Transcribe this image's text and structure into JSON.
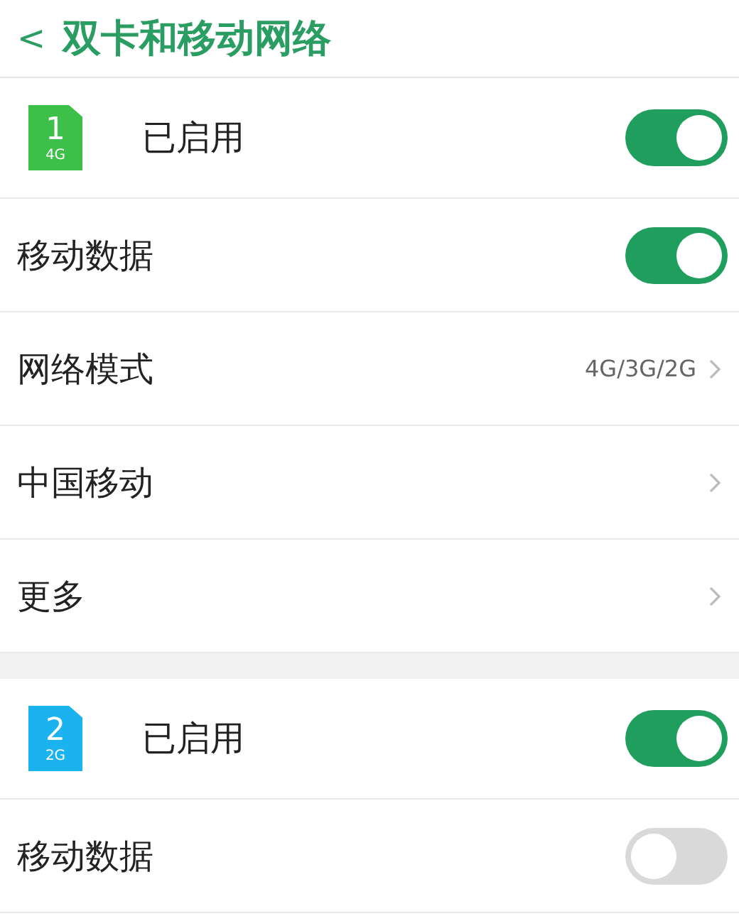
{
  "header": {
    "back": "<",
    "title": "双卡和移动网络"
  },
  "sections": [
    {
      "rows": [
        {
          "kind": "sim",
          "slot": "1",
          "network": "4G",
          "color": "#3cc04a",
          "label": "已启用",
          "on": true
        },
        {
          "kind": "toggle",
          "label": "移动数据",
          "on": true
        },
        {
          "kind": "link",
          "label": "网络模式",
          "value": "4G/3G/2G"
        },
        {
          "kind": "link",
          "label": "中国移动"
        },
        {
          "kind": "link",
          "label": "更多"
        }
      ]
    },
    {
      "rows": [
        {
          "kind": "sim",
          "slot": "2",
          "network": "2G",
          "color": "#1ab2ef",
          "label": "已启用",
          "on": true
        },
        {
          "kind": "toggle",
          "label": "移动数据",
          "on": false
        }
      ]
    }
  ]
}
